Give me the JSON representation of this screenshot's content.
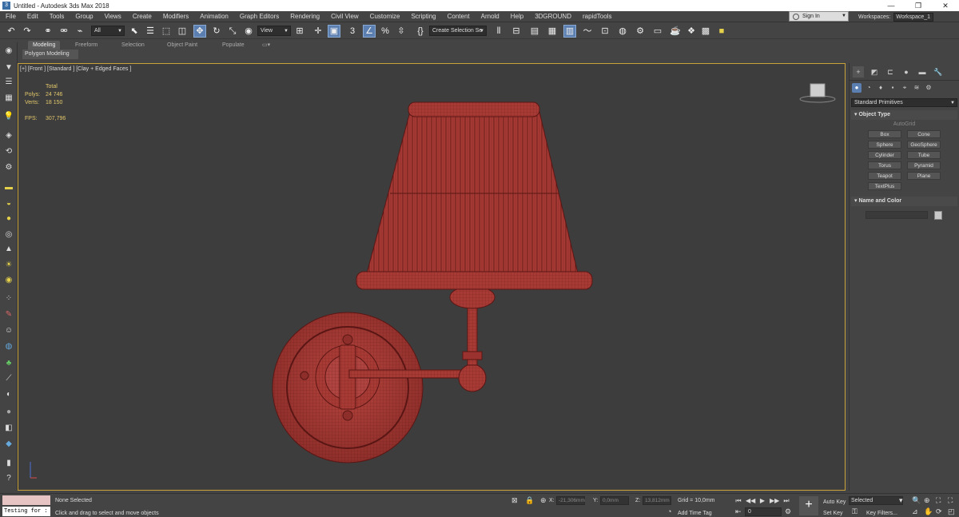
{
  "window": {
    "title": "Untitled - Autodesk 3ds Max 2018",
    "minimize": "—",
    "restore": "❐",
    "close": "✕"
  },
  "menu": [
    "File",
    "Edit",
    "Tools",
    "Group",
    "Views",
    "Create",
    "Modifiers",
    "Animation",
    "Graph Editors",
    "Rendering",
    "Civil View",
    "Customize",
    "Scripting",
    "Content",
    "Arnold",
    "Help",
    "3DGROUND",
    "rapidTools"
  ],
  "account": {
    "sign_in": "Sign In",
    "workspaces_label": "Workspaces:",
    "workspace": "Workspace_1"
  },
  "toolbar": {
    "selection_filter": "All",
    "reference_coord": "View",
    "snap_value": "3",
    "named_selection": "Create Selection Se"
  },
  "ribbon": {
    "tabs": [
      "Modeling",
      "Freeform",
      "Selection",
      "Object Paint",
      "Populate"
    ],
    "active_tab": "Modeling",
    "sub_label": "Polygon Modeling"
  },
  "viewport": {
    "label": "[+] [Front ] [Standard ] [Clay + Edged Faces ]",
    "stats": {
      "total_label": "Total",
      "polys_label": "Polys:",
      "polys": "24 746",
      "verts_label": "Verts:",
      "verts": "18 150",
      "fps_label": "FPS:",
      "fps": "307,796"
    },
    "mesh_color": "#a83a35",
    "wire_color": "#5a1614"
  },
  "command_panel": {
    "category": "Standard Primitives",
    "object_type_title": "Object Type",
    "autogrid": "AutoGrid",
    "primitives": [
      "Box",
      "Cone",
      "Sphere",
      "GeoSphere",
      "Cylinder",
      "Tube",
      "Torus",
      "Pyramid",
      "Teapot",
      "Plane",
      "TextPlus"
    ],
    "name_color_title": "Name and Color"
  },
  "status": {
    "none_selected": "None Selected",
    "prompt": "Click and drag to select and move objects",
    "maxscript": "Testing for :",
    "x_label": "X:",
    "x_value": "-21,306mm",
    "y_label": "Y:",
    "y_value": "0,0mm",
    "z_label": "Z:",
    "z_value": "13,812mm",
    "grid": "Grid = 10,0mm",
    "add_time_tag": "Add Time Tag",
    "auto_key": "Auto Key",
    "set_key": "Set Key",
    "selected": "Selected",
    "key_filters": "Key Filters...",
    "frame": "0"
  }
}
